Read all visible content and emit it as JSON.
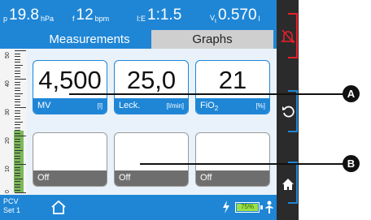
{
  "top_params": [
    {
      "label": "p",
      "value": "19.8",
      "unit": "hPa"
    },
    {
      "label": "f",
      "value": "12",
      "unit": "bpm"
    },
    {
      "label": "I:E",
      "value": "1:1.5",
      "unit": ""
    },
    {
      "label": "V",
      "sub": "t",
      "value": "0.570",
      "unit": "l"
    }
  ],
  "tabs": {
    "measurements": "Measurements",
    "graphs": "Graphs"
  },
  "scale": {
    "ticks": [
      "50",
      "40",
      "30",
      "20",
      "10",
      "0"
    ]
  },
  "boxes": [
    {
      "value": "4,500",
      "name": "MV",
      "unit": "[l]"
    },
    {
      "value": "25,0",
      "name": "Leck.",
      "unit": "[l/min]"
    },
    {
      "value": "21",
      "name": "FiO",
      "sub": "2",
      "unit": "[%]"
    },
    {
      "value": "",
      "name": "Off",
      "unit": ""
    },
    {
      "value": "",
      "name": "Off",
      "unit": ""
    },
    {
      "value": "",
      "name": "Off",
      "unit": ""
    }
  ],
  "bottom": {
    "mode_line1": "PCV",
    "mode_line2": "Set 1",
    "battery_pct": "75%"
  },
  "callouts": {
    "a": "A",
    "b": "B"
  },
  "colors": {
    "accent": "#1f86d6",
    "alarm": "#e8202a",
    "battery": "#9be04a",
    "pressure": "#7bb85a"
  },
  "icons": [
    "home-icon",
    "bolt-icon",
    "alarm-off-icon",
    "rotate-icon",
    "home-nav-icon",
    "bed-icon"
  ]
}
